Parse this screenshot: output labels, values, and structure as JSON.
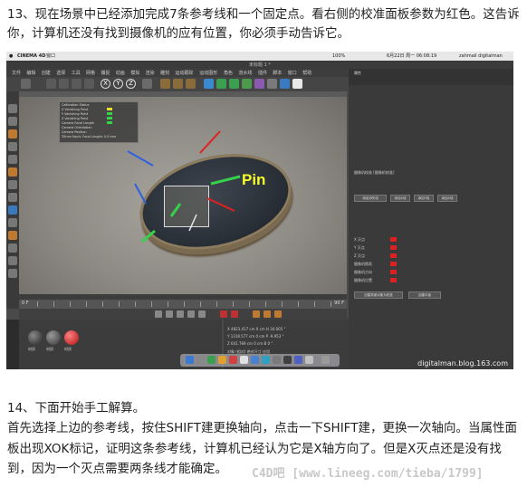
{
  "paragraph1": "13、现在场景中已经添加完成7条参考线和一个固定点。看右侧的校准面板参数为红色。这告诉你，计算机还没有找到摄像机的应有位置，你必须手动告诉它。",
  "screenshot": {
    "app_name": "CINEMA 4D",
    "mac_menu": [
      "CINEMA 4D",
      "窗口"
    ],
    "mac_status": "zahmail digitalman",
    "mac_time": "6月22日 周一 06:08:19",
    "battery": "100%",
    "window_title": "未标题 1 *",
    "menu_items": [
      "文件",
      "编辑",
      "创建",
      "选择",
      "工具",
      "网格",
      "捕捉",
      "动画",
      "模拟",
      "渲染",
      "雕刻",
      "运动跟踪",
      "运动图形",
      "角色",
      "流水线",
      "插件",
      "脚本",
      "窗口",
      "帮助"
    ],
    "viewport_label": "Pin",
    "calibration_lines": [
      "Calibration Status",
      "X Vanishing Point",
      "Y Vanishing Point",
      "Z Vanishing Point",
      "Camera Focal Length",
      "Camera Orientation",
      "Camera Position",
      "35mm Equiv. Focal Length: 0.0 mm"
    ],
    "timeline_start": "0 F",
    "timeline_end": "90 F",
    "materials": [
      "材质",
      "材质",
      "材质"
    ],
    "coords": [
      {
        "label": "X",
        "pos": "4823.417 cm",
        "size": "0 cm",
        "rot": "H 34.005 °"
      },
      {
        "label": "Y",
        "pos": "1318.577 cm",
        "size": "0 cm",
        "rot": "P -9.953 °"
      },
      {
        "label": "Z",
        "pos": "641.769 cm",
        "size": "0 cm",
        "rot": "B 0 °"
      }
    ],
    "coord_modes": [
      "对象 (相对)",
      "绝对尺寸",
      "应用"
    ],
    "attr_title": "属性",
    "attr_object": "摄像机校准 [摄像机校准]",
    "attr_rows": [
      "X 灭点",
      "Y 灭点",
      "Z 灭点",
      "摄像机焦距",
      "摄像机方向",
      "摄像机位置"
    ],
    "attr_buttons": [
      "添加消失线",
      "添加X线",
      "添加Y线",
      "添加Z线"
    ],
    "attr_bottom_buttons": [
      "创建背景对象为校准",
      "创建平面"
    ],
    "site_watermark": "digitalman.blog.163.com",
    "colors": {
      "calibration_status": "#e02020",
      "pin_label": "#f6ff2a",
      "arrow_green": "#35d24a",
      "arrow_red": "#e02020",
      "arrow_blue": "#3060e0"
    }
  },
  "paragraph2": "14、下面开始手工解算。",
  "paragraph3": "首先选择上边的参考线，按住SHIFT建更换轴向，点击一下SHIFT建，更换一次轴向。当属性面板出现XOK标记，证明这条参考线，计算机已经认为它是X轴方向了。但是X灭点还是没有找到，因为一个灭点需要两条线才能确定。",
  "footer_watermark": "C4D吧 [www.lineeg.com/tieba/1799]"
}
